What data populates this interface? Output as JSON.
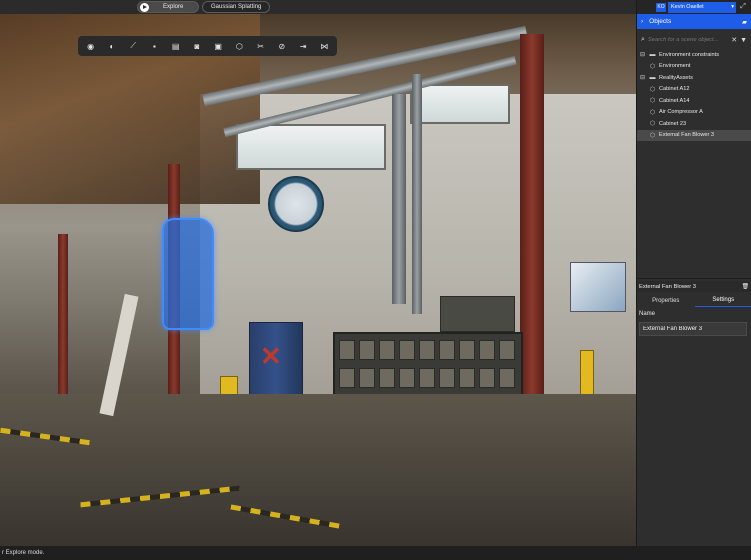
{
  "topbar": {
    "modes": [
      {
        "label": "Explore",
        "active": true
      },
      {
        "label": "Gaussian Splatting",
        "active": false
      }
    ]
  },
  "toolbar": {
    "tools": [
      {
        "name": "visibility-icon",
        "glyph": "◉"
      },
      {
        "name": "contrast-icon",
        "glyph": "◐"
      },
      {
        "name": "measure-icon",
        "glyph": "⟋"
      },
      {
        "name": "comment-icon",
        "glyph": "▪"
      },
      {
        "name": "document-icon",
        "glyph": "▤"
      },
      {
        "name": "camera-icon",
        "glyph": "◙"
      },
      {
        "name": "image-icon",
        "glyph": "▣"
      },
      {
        "name": "cube-icon",
        "glyph": "⬡"
      },
      {
        "name": "scissors-icon",
        "glyph": "✂"
      },
      {
        "name": "link-icon",
        "glyph": "⊘"
      },
      {
        "name": "export-icon",
        "glyph": "⇥"
      },
      {
        "name": "share-icon",
        "glyph": "⋈"
      }
    ]
  },
  "user": {
    "initials": "KO",
    "name": "Kevin Oaellet"
  },
  "objects_panel": {
    "title": "Objects",
    "search_placeholder": "Search for a scene object...",
    "tree": [
      {
        "label": "Environment constraints",
        "type": "group"
      },
      {
        "label": "Environment",
        "type": "child"
      },
      {
        "label": "RealityAssets",
        "type": "group"
      },
      {
        "label": "Cabinet A12",
        "type": "child"
      },
      {
        "label": "Cabinet A14",
        "type": "child"
      },
      {
        "label": "Air Compressor A",
        "type": "child"
      },
      {
        "label": "Cabinet 23",
        "type": "child"
      },
      {
        "label": "External Fan Blower 3",
        "type": "child",
        "selected": true
      }
    ]
  },
  "properties": {
    "title": "External Fan Blower 3",
    "tabs": [
      {
        "label": "Properties",
        "active": false
      },
      {
        "label": "Settings",
        "active": true
      }
    ],
    "name_label": "Name",
    "name_value": "External Fan Blower 3"
  },
  "status": {
    "text": "r Explore mode."
  },
  "colors": {
    "accent": "#1e5de8",
    "highlight": "#3f8bff"
  }
}
